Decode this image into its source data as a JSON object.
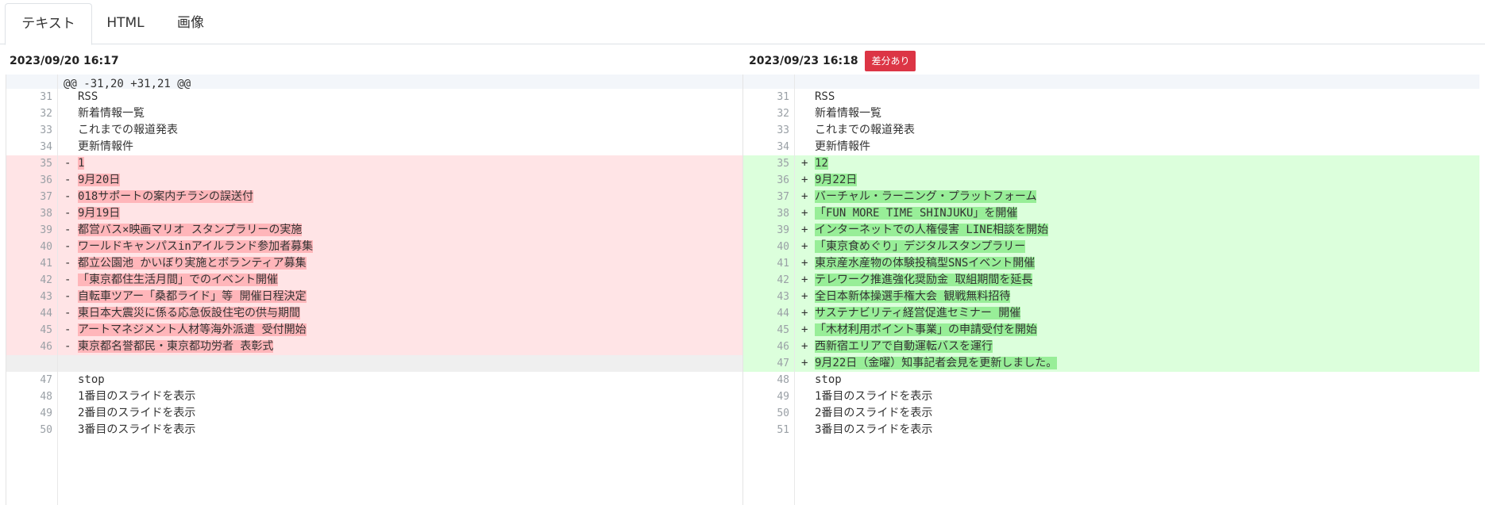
{
  "tabs": [
    {
      "label": "テキスト",
      "active": true
    },
    {
      "label": "HTML",
      "active": false
    },
    {
      "label": "画像",
      "active": false
    }
  ],
  "left_header": {
    "date": "2023/09/20 16:17"
  },
  "right_header": {
    "date": "2023/09/23 16:18",
    "badge": "差分あり"
  },
  "hunk_header": "@@ -31,20 +31,21 @@",
  "colors": {
    "deleted": "#ffe4e6",
    "deleted_highlight": "#ffb6ba",
    "added": "#dcffdc",
    "added_highlight": "#98ee98",
    "badge": "#dc3545"
  },
  "left_rows": [
    {
      "type": "context",
      "num": "31",
      "sign": "",
      "text": "RSS"
    },
    {
      "type": "context",
      "num": "32",
      "sign": "",
      "text": "新着情報一覧"
    },
    {
      "type": "context",
      "num": "33",
      "sign": "",
      "text": "これまでの報道発表"
    },
    {
      "type": "context",
      "num": "34",
      "sign": "",
      "text": "更新情報件"
    },
    {
      "type": "del",
      "num": "35",
      "sign": "-",
      "text": "1"
    },
    {
      "type": "del",
      "num": "36",
      "sign": "-",
      "text": "9月20日"
    },
    {
      "type": "del",
      "num": "37",
      "sign": "-",
      "text": "018サポートの案内チラシの誤送付"
    },
    {
      "type": "del",
      "num": "38",
      "sign": "-",
      "text": "9月19日"
    },
    {
      "type": "del",
      "num": "39",
      "sign": "-",
      "text": "都営バス×映画マリオ スタンプラリーの実施"
    },
    {
      "type": "del",
      "num": "40",
      "sign": "-",
      "text": "ワールドキャンパスinアイルランド参加者募集"
    },
    {
      "type": "del",
      "num": "41",
      "sign": "-",
      "text": "都立公園池 かいぼり実施とボランティア募集"
    },
    {
      "type": "del",
      "num": "42",
      "sign": "-",
      "text": "「東京都住生活月間」でのイベント開催"
    },
    {
      "type": "del",
      "num": "43",
      "sign": "-",
      "text": "自転車ツアー「桑都ライド」等 開催日程決定"
    },
    {
      "type": "del",
      "num": "44",
      "sign": "-",
      "text": "東日本大震災に係る応急仮設住宅の供与期間"
    },
    {
      "type": "del",
      "num": "45",
      "sign": "-",
      "text": "アートマネジメント人材等海外派遣 受付開始"
    },
    {
      "type": "del",
      "num": "46",
      "sign": "-",
      "text": "東京都名誉都民・東京都功労者 表彰式"
    },
    {
      "type": "empty",
      "num": "",
      "sign": "",
      "text": ""
    },
    {
      "type": "context",
      "num": "47",
      "sign": "",
      "text": "stop"
    },
    {
      "type": "context",
      "num": "48",
      "sign": "",
      "text": "1番目のスライドを表示"
    },
    {
      "type": "context",
      "num": "49",
      "sign": "",
      "text": "2番目のスライドを表示"
    },
    {
      "type": "context",
      "num": "50",
      "sign": "",
      "text": "3番目のスライドを表示"
    }
  ],
  "right_rows": [
    {
      "type": "context",
      "num": "31",
      "sign": "",
      "text": "RSS"
    },
    {
      "type": "context",
      "num": "32",
      "sign": "",
      "text": "新着情報一覧"
    },
    {
      "type": "context",
      "num": "33",
      "sign": "",
      "text": "これまでの報道発表"
    },
    {
      "type": "context",
      "num": "34",
      "sign": "",
      "text": "更新情報件"
    },
    {
      "type": "add",
      "num": "35",
      "sign": "+",
      "text": "12"
    },
    {
      "type": "add",
      "num": "36",
      "sign": "+",
      "text": "9月22日"
    },
    {
      "type": "add",
      "num": "37",
      "sign": "+",
      "text": "バーチャル・ラーニング・プラットフォーム"
    },
    {
      "type": "add",
      "num": "38",
      "sign": "+",
      "text": "「FUN MORE TIME SHINJUKU」を開催"
    },
    {
      "type": "add",
      "num": "39",
      "sign": "+",
      "text": "インターネットでの人権侵害 LINE相談を開始"
    },
    {
      "type": "add",
      "num": "40",
      "sign": "+",
      "text": "「東京食めぐり」デジタルスタンプラリー"
    },
    {
      "type": "add",
      "num": "41",
      "sign": "+",
      "text": "東京産水産物の体験投稿型SNSイベント開催"
    },
    {
      "type": "add",
      "num": "42",
      "sign": "+",
      "text": "テレワーク推進強化奨励金 取組期間を延長"
    },
    {
      "type": "add",
      "num": "43",
      "sign": "+",
      "text": "全日本新体操選手権大会 観戦無料招待"
    },
    {
      "type": "add",
      "num": "44",
      "sign": "+",
      "text": "サステナビリティ経営促進セミナー 開催"
    },
    {
      "type": "add",
      "num": "45",
      "sign": "+",
      "text": "「木材利用ポイント事業」の申請受付を開始"
    },
    {
      "type": "add",
      "num": "46",
      "sign": "+",
      "text": "西新宿エリアで自動運転バスを運行"
    },
    {
      "type": "add",
      "num": "47",
      "sign": "+",
      "text": "9月22日（金曜）知事記者会見を更新しました。"
    },
    {
      "type": "context",
      "num": "48",
      "sign": "",
      "text": "stop"
    },
    {
      "type": "context",
      "num": "49",
      "sign": "",
      "text": "1番目のスライドを表示"
    },
    {
      "type": "context",
      "num": "50",
      "sign": "",
      "text": "2番目のスライドを表示"
    },
    {
      "type": "context",
      "num": "51",
      "sign": "",
      "text": "3番目のスライドを表示"
    }
  ]
}
